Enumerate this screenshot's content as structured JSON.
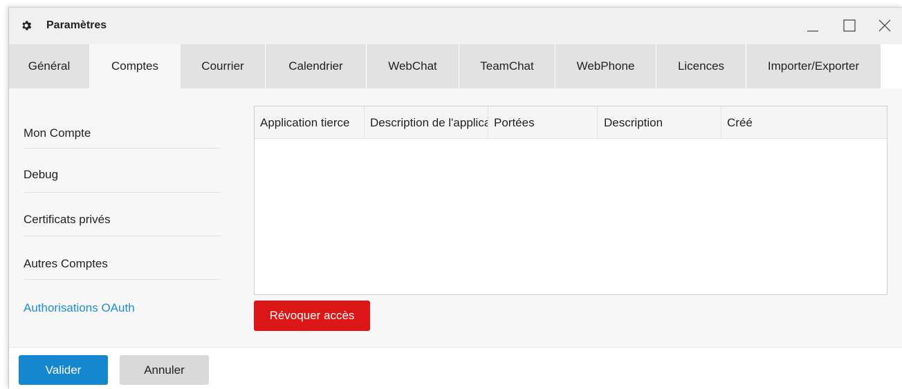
{
  "window": {
    "title": "Paramètres",
    "title_icon": "gear-icon",
    "controls": [
      "minimize-icon",
      "maximize-icon",
      "close-icon"
    ]
  },
  "tabs": [
    {
      "label": "Général"
    },
    {
      "label": "Comptes",
      "active": true
    },
    {
      "label": "Courrier"
    },
    {
      "label": "Calendrier"
    },
    {
      "label": "WebChat"
    },
    {
      "label": "TeamChat"
    },
    {
      "label": "WebPhone"
    },
    {
      "label": "Licences"
    },
    {
      "label": "Importer/Exporter"
    }
  ],
  "sidebar": {
    "items": [
      {
        "label": "Mon Compte"
      },
      {
        "label": "Debug"
      },
      {
        "label": "Certificats privés"
      },
      {
        "label": "Autres Comptes"
      },
      {
        "label": "Authorisations OAuth",
        "active": true
      }
    ]
  },
  "grid": {
    "columns": [
      {
        "label": "Application tierce"
      },
      {
        "label": "Description de l'application"
      },
      {
        "label": "Portées"
      },
      {
        "label": "Description"
      },
      {
        "label": "Créé"
      }
    ],
    "rows": []
  },
  "actions": {
    "revoke_label": "Révoquer accès"
  },
  "footer": {
    "ok_label": "Valider",
    "cancel_label": "Annuler"
  },
  "colors": {
    "primary": "#1487cf",
    "danger": "#dc1616",
    "active_link": "#1e8ecf"
  }
}
